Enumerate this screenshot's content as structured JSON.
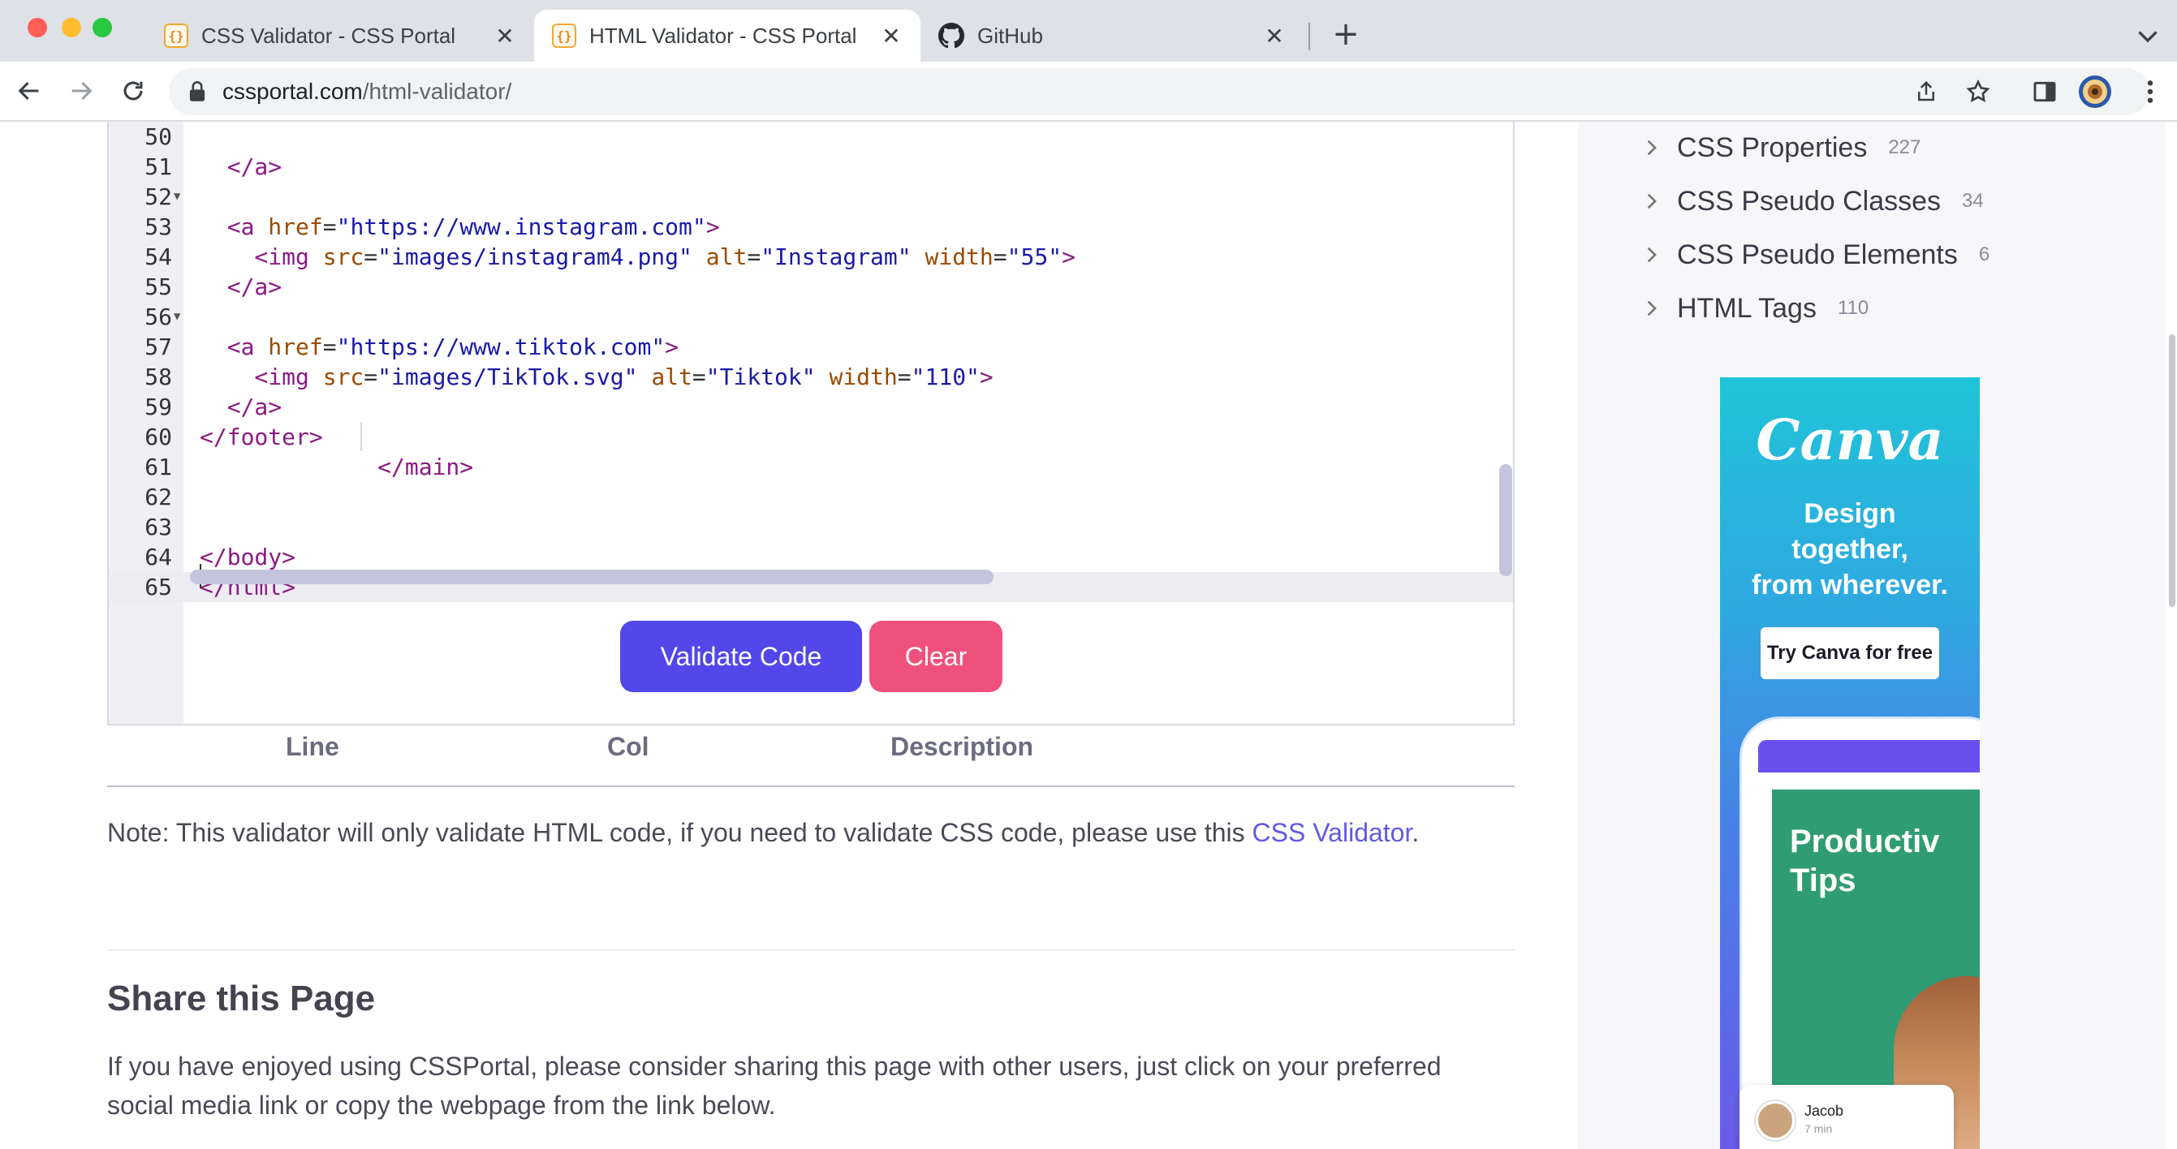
{
  "browser": {
    "tabs": [
      {
        "title": "CSS Validator - CSS Portal",
        "favicon": "css-portal-icon",
        "active": false
      },
      {
        "title": "HTML Validator - CSS Portal",
        "favicon": "css-portal-icon",
        "active": true
      },
      {
        "title": "GitHub",
        "favicon": "github-icon",
        "active": false
      }
    ],
    "favicon_glyph": "{}",
    "new_tab_label": "+",
    "close_glyph": "✕",
    "url_domain": "cssportal.com",
    "url_path": "/html-validator/"
  },
  "editor": {
    "lines": [
      {
        "n": "50",
        "fold": false,
        "current": false
      },
      {
        "n": "51",
        "fold": false,
        "current": false
      },
      {
        "n": "52",
        "fold": true,
        "current": false
      },
      {
        "n": "53",
        "fold": false,
        "current": false
      },
      {
        "n": "54",
        "fold": false,
        "current": false
      },
      {
        "n": "55",
        "fold": false,
        "current": false
      },
      {
        "n": "56",
        "fold": true,
        "current": false
      },
      {
        "n": "57",
        "fold": false,
        "current": false
      },
      {
        "n": "58",
        "fold": false,
        "current": false
      },
      {
        "n": "59",
        "fold": false,
        "current": false
      },
      {
        "n": "60",
        "fold": false,
        "current": false
      },
      {
        "n": "61",
        "fold": false,
        "current": false
      },
      {
        "n": "62",
        "fold": false,
        "current": false
      },
      {
        "n": "63",
        "fold": false,
        "current": false
      },
      {
        "n": "64",
        "fold": false,
        "current": false
      },
      {
        "n": "65",
        "fold": false,
        "current": true
      }
    ],
    "fold_glyph": "▼",
    "code": {
      "l50_close_a": "  </a>",
      "l52_open": "  <a ",
      "l52_attr": "href",
      "l52_eq": "=",
      "l52_val": "\"https://www.instagram.com\"",
      "l52_close": ">",
      "l53_open": "    <img ",
      "l53_attr1": "src",
      "l53_val1": "\"images/instagram4.png\"",
      "l53_attr2": "alt",
      "l53_val2": "\"Instagram\"",
      "l53_attr3": "width",
      "l53_val3": "\"55\"",
      "l53_close": ">",
      "l54": "  </a>",
      "l56_open": "  <a ",
      "l56_attr": "href",
      "l56_val": "\"https://www.tiktok.com\"",
      "l56_close": ">",
      "l57_open": "    <img ",
      "l57_attr1": "src",
      "l57_val1": "\"images/TikTok.svg\"",
      "l57_attr2": "alt",
      "l57_val2": "\"Tiktok\"",
      "l57_attr3": "width",
      "l57_val3": "\"110\"",
      "l57_close": ">",
      "l58": "  </a>",
      "l59": "</footer>",
      "l60": "             </main>",
      "l63": "</body>",
      "l64": "</html>",
      "eq": "=",
      "space": " "
    }
  },
  "actions": {
    "validate_label": "Validate Code",
    "clear_label": "Clear"
  },
  "results": {
    "columns": [
      "Line",
      "Col",
      "Description"
    ]
  },
  "note": {
    "text": "Note: This validator will only validate HTML code, if you need to validate CSS code, please use this ",
    "link_text": "CSS Validator",
    "suffix": "."
  },
  "share": {
    "title": "Share this Page",
    "text": "If you have enjoyed using CSSPortal, please consider sharing this page with other users, just click on your preferred social media link or copy the webpage from the link below."
  },
  "sidebar": {
    "items": [
      {
        "label": "CSS Properties",
        "count": "227"
      },
      {
        "label": "CSS Pseudo Classes",
        "count": "34"
      },
      {
        "label": "CSS Pseudo Elements",
        "count": "6"
      },
      {
        "label": "HTML Tags",
        "count": "110"
      }
    ]
  },
  "ad": {
    "brand": "Canva",
    "headline_1": "Design",
    "headline_2": "together,",
    "headline_3": "from wherever.",
    "cta": "Try Canva for free",
    "card_title_1": "Productiv",
    "card_title_2": "Tips",
    "chat_name": "Jacob",
    "chat_time": "7 min"
  },
  "colors": {
    "primary_button": "#5247e9",
    "clear_button": "#f0517b",
    "link": "#6159e6",
    "tag": "#8b1a83",
    "attribute": "#9b4a00",
    "string": "#1a1aa6"
  }
}
